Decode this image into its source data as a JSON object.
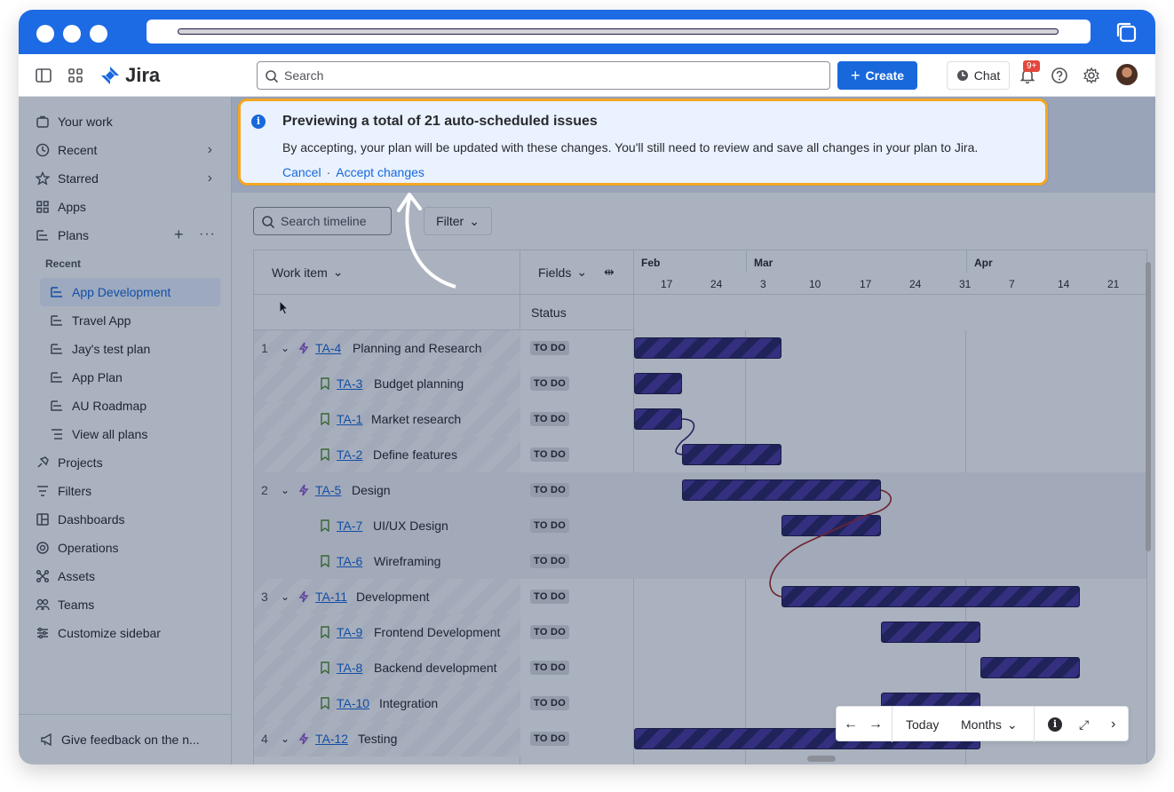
{
  "browser": {
    "url_placeholder": ""
  },
  "topnav": {
    "app_name": "Jira",
    "search_placeholder": "Search",
    "create_label": "Create",
    "chat_label": "Chat",
    "notifications_badge": "9+"
  },
  "sidebar": {
    "items": [
      {
        "label": "Your work",
        "icon": "your-work-icon"
      },
      {
        "label": "Recent",
        "icon": "clock-icon"
      },
      {
        "label": "Starred",
        "icon": "star-icon"
      },
      {
        "label": "Apps",
        "icon": "apps-icon"
      },
      {
        "label": "Plans",
        "icon": "plans-icon"
      }
    ],
    "recent_label": "Recent",
    "plans": [
      {
        "label": "App Development",
        "active": true
      },
      {
        "label": "Travel App"
      },
      {
        "label": "Jay's test plan"
      },
      {
        "label": "App Plan"
      },
      {
        "label": "AU Roadmap"
      },
      {
        "label": "View all plans"
      }
    ],
    "more_items": [
      {
        "label": "Projects",
        "icon": "projects-icon"
      },
      {
        "label": "Filters",
        "icon": "filters-icon"
      },
      {
        "label": "Dashboards",
        "icon": "dashboards-icon"
      },
      {
        "label": "Operations",
        "icon": "operations-icon"
      },
      {
        "label": "Assets",
        "icon": "assets-icon"
      },
      {
        "label": "Teams",
        "icon": "teams-icon"
      },
      {
        "label": "Customize sidebar",
        "icon": "customize-icon"
      }
    ],
    "feedback_label": "Give feedback on the n..."
  },
  "banner": {
    "title": "Previewing a total of 21 auto-scheduled issues",
    "message": "By accepting, your plan will be updated with these changes. You'll still need to review and save all changes in your plan to Jira.",
    "cancel_label": "Cancel",
    "separator": "·",
    "accept_label": "Accept changes"
  },
  "timeline": {
    "search_placeholder": "Search timeline",
    "filter_label": "Filter",
    "work_item_header": "Work item",
    "fields_header": "Fields",
    "status_header": "Status",
    "months": [
      "Feb",
      "Mar",
      "Apr"
    ],
    "weeks": [
      "17",
      "24",
      "3",
      "10",
      "17",
      "24",
      "31",
      "7",
      "14",
      "21"
    ]
  },
  "rows": [
    {
      "num": "1",
      "key": "TA-4",
      "title": "Planning and Research",
      "type": "epic",
      "status": "TO DO"
    },
    {
      "key": "TA-3",
      "title": "Budget planning",
      "type": "story",
      "status": "TO DO"
    },
    {
      "key": "TA-1",
      "title": "Market research",
      "type": "story",
      "status": "TO DO"
    },
    {
      "key": "TA-2",
      "title": "Define features",
      "type": "story",
      "status": "TO DO"
    },
    {
      "num": "2",
      "key": "TA-5",
      "title": "Design",
      "type": "epic",
      "status": "TO DO"
    },
    {
      "key": "TA-7",
      "title": "UI/UX Design",
      "type": "story",
      "status": "TO DO"
    },
    {
      "key": "TA-6",
      "title": "Wireframing",
      "type": "story",
      "status": "TO DO"
    },
    {
      "num": "3",
      "key": "TA-11",
      "title": "Development",
      "type": "epic",
      "status": "TO DO"
    },
    {
      "key": "TA-9",
      "title": "Frontend Development",
      "type": "story",
      "status": "TO DO"
    },
    {
      "key": "TA-8",
      "title": "Backend development",
      "type": "story",
      "status": "TO DO"
    },
    {
      "key": "TA-10",
      "title": "Integration",
      "type": "story",
      "status": "TO DO"
    },
    {
      "num": "4",
      "key": "TA-12",
      "title": "Testing",
      "type": "epic",
      "status": "TO DO"
    }
  ],
  "toolbar": {
    "today_label": "Today",
    "months_label": "Months"
  },
  "colors": {
    "accent": "#1868db",
    "banner_border": "#f5a623",
    "bar": "#2d2665",
    "dependency": "#a3262a"
  }
}
